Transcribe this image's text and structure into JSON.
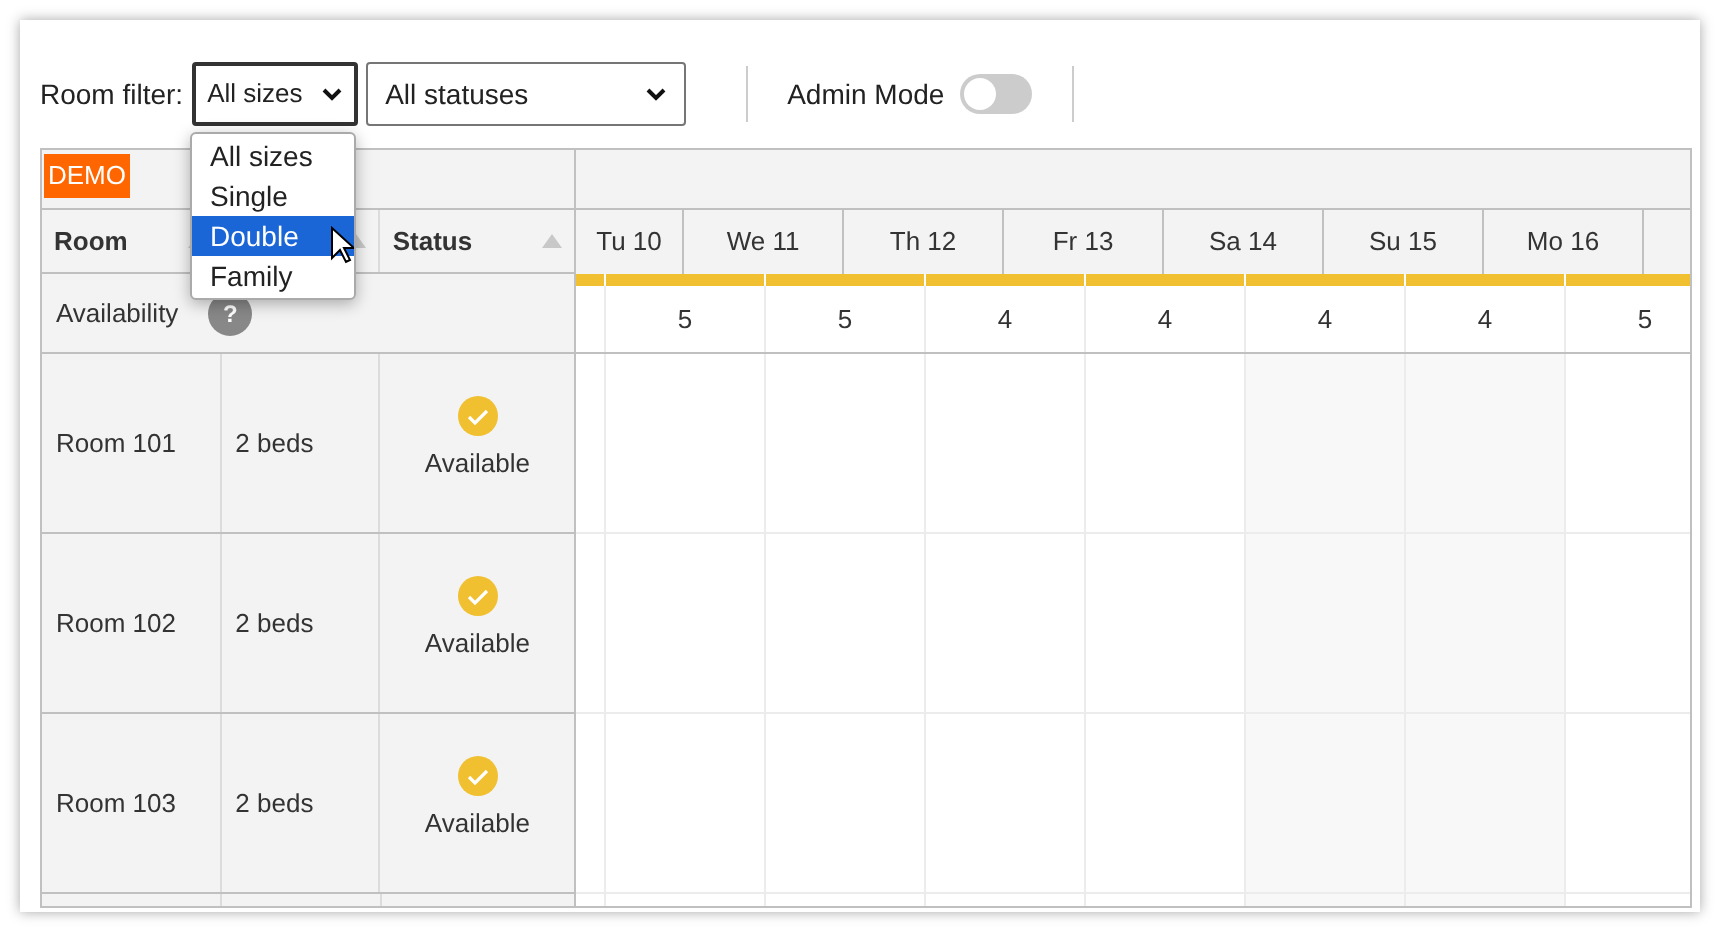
{
  "toolbar": {
    "filter_label": "Room filter:",
    "size_select": {
      "value": "All sizes",
      "expanded": true,
      "options": [
        {
          "label": "All sizes",
          "highlighted": false
        },
        {
          "label": "Single",
          "highlighted": false
        },
        {
          "label": "Double",
          "highlighted": true
        },
        {
          "label": "Family",
          "highlighted": false
        }
      ]
    },
    "status_select": {
      "value": "All statuses"
    },
    "admin_mode": {
      "label": "Admin Mode",
      "on": false
    }
  },
  "badge": "DEMO",
  "columns": [
    {
      "label": "Room",
      "sort_arrow": true
    },
    {
      "sort_arrow": true
    },
    {
      "label": "Status",
      "sort_arrow": true
    }
  ],
  "days": [
    "Tu 10",
    "We 11",
    "Th 12",
    "Fr 13",
    "Sa 14",
    "Su 15",
    "Mo 16"
  ],
  "availability": {
    "label": "Availability",
    "help_icon": "?",
    "values": [
      "5",
      "5",
      "4",
      "4",
      "4",
      "4",
      "5"
    ]
  },
  "rooms": [
    {
      "name": "Room 101",
      "size": "2 beds",
      "status": "Available"
    },
    {
      "name": "Room 102",
      "size": "2 beds",
      "status": "Available"
    },
    {
      "name": "Room 103",
      "size": "2 beds",
      "status": "Available"
    }
  ]
}
